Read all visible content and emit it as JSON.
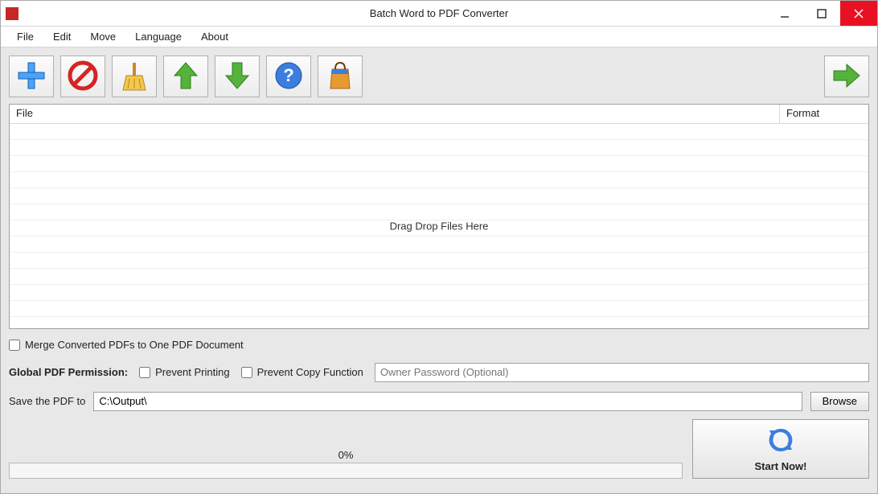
{
  "window": {
    "title": "Batch Word to PDF Converter"
  },
  "menu": {
    "items": [
      "File",
      "Edit",
      "Move",
      "Language",
      "About"
    ]
  },
  "toolbar": {
    "buttons": [
      {
        "name": "add",
        "title": "Add"
      },
      {
        "name": "remove",
        "title": "Remove"
      },
      {
        "name": "clear",
        "title": "Clear"
      },
      {
        "name": "move-up",
        "title": "Move Up"
      },
      {
        "name": "move-down",
        "title": "Move Down"
      },
      {
        "name": "help",
        "title": "Help"
      },
      {
        "name": "shop",
        "title": "Shop"
      }
    ],
    "go": {
      "name": "go",
      "title": "Go"
    }
  },
  "grid": {
    "columns": {
      "file": "File",
      "format": "Format"
    },
    "drop_text": "Drag  Drop Files Here"
  },
  "options": {
    "merge_label": "Merge Converted PDFs to One PDF Document",
    "permission_label": "Global PDF Permission:",
    "prevent_print_label": "Prevent Printing",
    "prevent_copy_label": "Prevent Copy Function",
    "owner_pw_placeholder": "Owner Password (Optional)"
  },
  "save": {
    "label": "Save the PDF to",
    "path": "C:\\Output\\",
    "browse_label": "Browse"
  },
  "progress": {
    "text": "0%"
  },
  "start": {
    "label": "Start Now!"
  }
}
